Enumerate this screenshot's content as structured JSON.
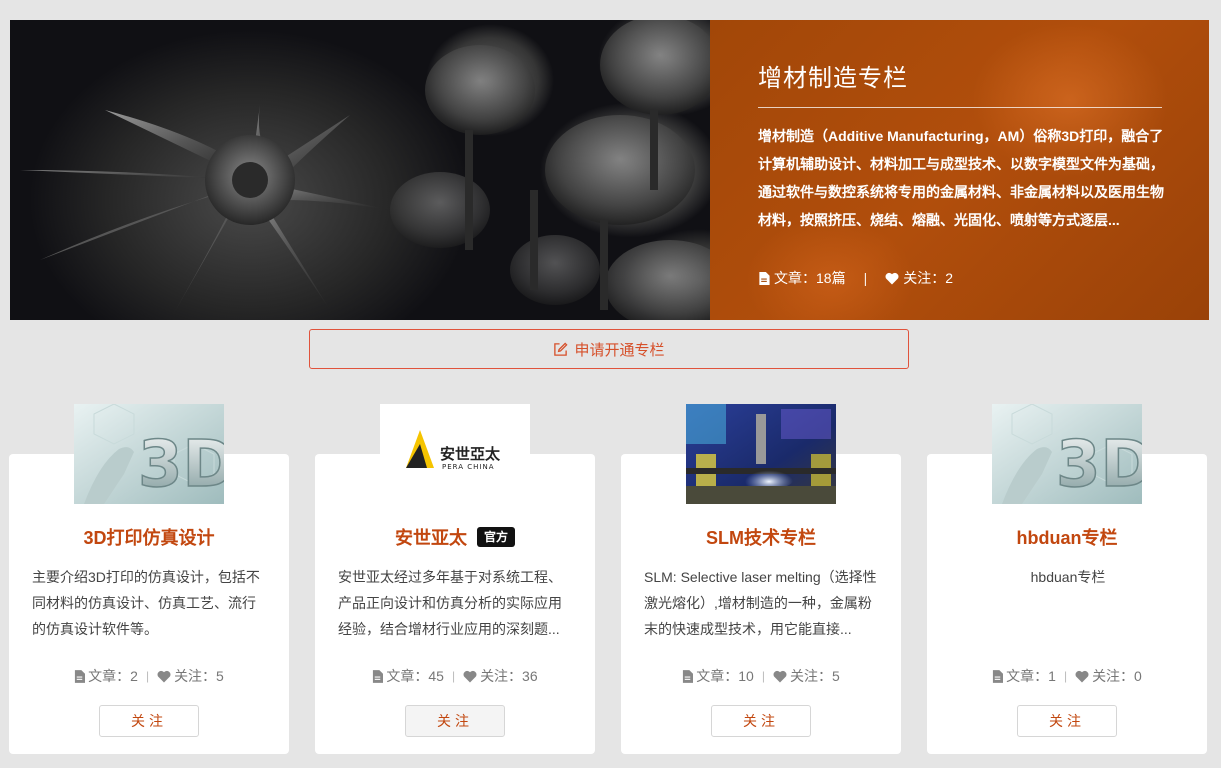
{
  "hero": {
    "title": "增材制造专栏",
    "description": "增材制造（Additive Manufacturing，AM）俗称3D打印，融合了计算机辅助设计、材料加工与成型技术、以数字模型文件为基础，通过软件与数控系统将专用的金属材料、非金属材料以及医用生物材料，按照挤压、烧结、熔融、光固化、喷射等方式逐层...",
    "articles": "文章：18篇",
    "separator": "|",
    "follows": "关注：2",
    "panel_color": "#a54808"
  },
  "apply": {
    "label": "申请开通专栏",
    "color": "#d6502a"
  },
  "cards": [
    {
      "title": "3D打印仿真设计",
      "badge": "",
      "description": "主要介绍3D打印的仿真设计，包括不同材料的仿真设计、仿真工艺、流行的仿真设计软件等。",
      "articles": "文章：2",
      "follows": "关注：5",
      "follow_label": "关注",
      "thumb": "3d-graphic-icon"
    },
    {
      "title": "安世亚太",
      "badge": "官方",
      "description": "安世亚太经过多年基于对系统工程、产品正向设计和仿真分析的实际应用经验，结合增材行业应用的深刻题...",
      "articles": "文章：45",
      "follows": "关注：36",
      "follow_label": "关注",
      "thumb": "pera-china-logo",
      "logo_text": "安世亞太",
      "logo_sub": "PERA CHINA"
    },
    {
      "title": "SLM技术专栏",
      "badge": "",
      "description": "SLM: Selective laser melting（选择性激光熔化）,增材制造的一种，金属粉末的快速成型技术，用它能直接...",
      "articles": "文章：10",
      "follows": "关注：5",
      "follow_label": "关注",
      "thumb": "printer-photo"
    },
    {
      "title": "hbduan专栏",
      "badge": "",
      "description": "hbduan专栏",
      "articles": "文章：1",
      "follows": "关注：0",
      "follow_label": "关注",
      "thumb": "3d-graphic-icon"
    }
  ],
  "colors": {
    "accent": "#c2470f",
    "background": "#e5e5e5"
  }
}
